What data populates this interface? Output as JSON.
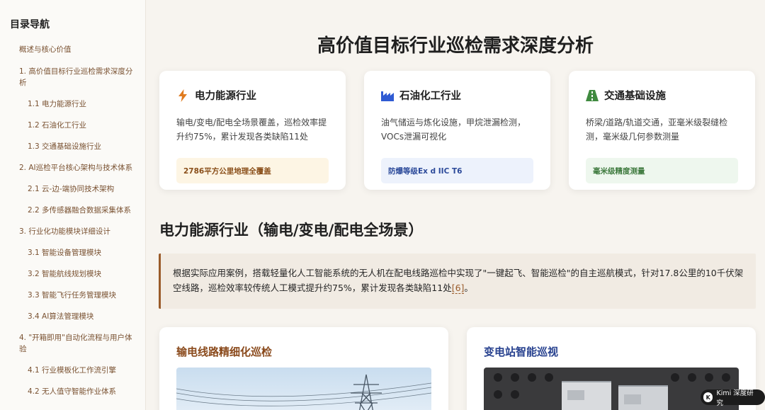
{
  "sidebar": {
    "title": "目录导航",
    "items": [
      {
        "label": "概述与核心价值",
        "level": 1
      },
      {
        "label": "1. 高价值目标行业巡检需求深度分析",
        "level": 1
      },
      {
        "label": "1.1 电力能源行业",
        "level": 2
      },
      {
        "label": "1.2 石油化工行业",
        "level": 2
      },
      {
        "label": "1.3 交通基础设施行业",
        "level": 2
      },
      {
        "label": "2. AI巡检平台核心架构与技术体系",
        "level": 1
      },
      {
        "label": "2.1 云-边-端协同技术架构",
        "level": 2
      },
      {
        "label": "2.2 多传感器融合数据采集体系",
        "level": 2
      },
      {
        "label": "3. 行业化功能模块详细设计",
        "level": 1
      },
      {
        "label": "3.1 智能设备管理模块",
        "level": 2
      },
      {
        "label": "3.2 智能航线规划模块",
        "level": 2
      },
      {
        "label": "3.3 智能飞行任务管理模块",
        "level": 2
      },
      {
        "label": "3.4 AI算法管理模块",
        "level": 2
      },
      {
        "label": "4. \"开箱即用\"自动化流程与用户体验",
        "level": 1
      },
      {
        "label": "4.1 行业模板化工作流引擎",
        "level": 2
      },
      {
        "label": "4.2 无人值守智能作业体系",
        "level": 2
      }
    ]
  },
  "main": {
    "title": "高价值目标行业巡检需求深度分析",
    "cards": [
      {
        "icon": "bolt-icon",
        "title": "电力能源行业",
        "desc": "输电/变电/配电全场景覆盖，巡检效率提升约75%，累计发现各类缺陷11处",
        "tag": "2786平方公里地理全覆盖",
        "color": "#e07b1f"
      },
      {
        "icon": "industry-icon",
        "title": "石油化工行业",
        "desc": "油气储运与炼化设施，甲烷泄漏检测，VOCs泄漏可视化",
        "tag": "防爆等级Ex d IIC T6",
        "color": "#2f5bd3"
      },
      {
        "icon": "road-icon",
        "title": "交通基础设施",
        "desc": "桥梁/道路/轨道交通，亚毫米级裂缝检测，毫米级几何参数测量",
        "tag": "毫米级精度测量",
        "color": "#3f8a3f"
      }
    ],
    "section_title": "电力能源行业（输电/变电/配电全场景）",
    "quote": {
      "text": "根据实际应用案例，搭载轻量化人工智能系统的无人机在配电线路巡检中实现了\"一键起飞、智能巡检\"的自主巡航模式，针对17.8公里的10千伏架空线路，巡检效率较传统人工模式提升约75%，累计发现各类缺陷11处",
      "cite": "[6]",
      "tail": "。"
    },
    "panels": [
      {
        "title": "输电线路精细化巡检",
        "color": "#8a4a1c"
      },
      {
        "title": "变电站智能巡视",
        "color": "#27418f"
      }
    ]
  },
  "badge": {
    "mark": "K",
    "label": "Kimi 深度研究"
  }
}
